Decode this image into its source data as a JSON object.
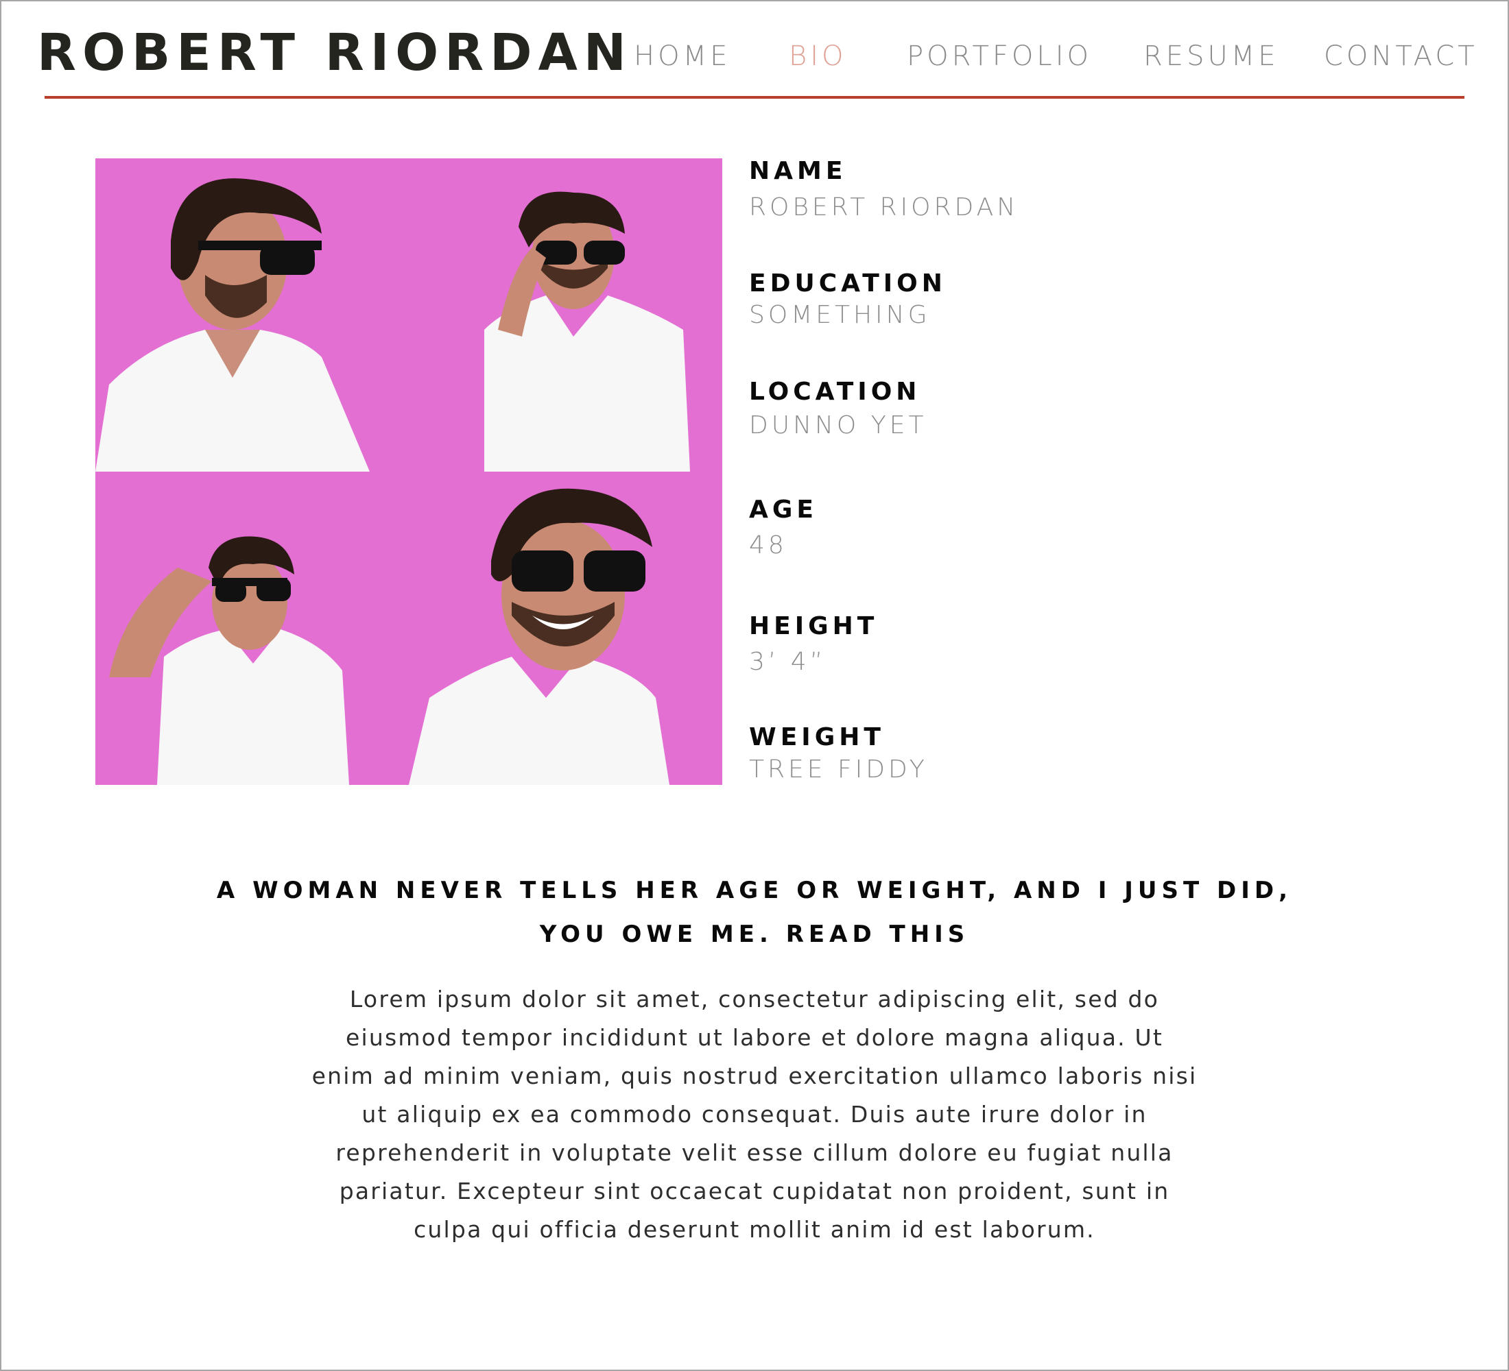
{
  "site": {
    "title": "ROBERT RIORDAN"
  },
  "nav": {
    "items": [
      {
        "label": "HOME",
        "active": false
      },
      {
        "label": "BIO",
        "active": true
      },
      {
        "label": "PORTFOLIO",
        "active": false
      },
      {
        "label": "RESUME",
        "active": false
      },
      {
        "label": "CONTACT",
        "active": false
      }
    ]
  },
  "profile": {
    "fields": [
      {
        "label": "NAME",
        "value": "ROBERT RIORDAN"
      },
      {
        "label": "EDUCATION",
        "value": "SOMETHING"
      },
      {
        "label": "LOCATION",
        "value": "DUNNO YET"
      },
      {
        "label": "AGE",
        "value": "48"
      },
      {
        "label": "HEIGHT",
        "value": "3’ 4”"
      },
      {
        "label": "WEIGHT",
        "value": "TREE FIDDY"
      }
    ]
  },
  "quote": {
    "lines": [
      "A WOMAN NEVER TELLS HER AGE OR WEIGHT, AND I JUST DID,",
      "YOU OWE ME. READ THIS"
    ]
  },
  "bio": {
    "lines": [
      "Lorem ipsum dolor sit amet, consectetur adipiscing elit, sed do",
      "eiusmod tempor incididunt ut labore et dolore magna aliqua. Ut",
      "enim ad minim veniam, quis nostrud exercitation ullamco laboris nisi",
      "ut aliquip ex ea commodo consequat. Duis aute irure dolor in",
      "reprehenderit in voluptate velit esse cillum dolore eu fugiat nulla",
      "pariatur. Excepteur sint occaecat cupidatat non proident, sunt in",
      "culpa qui officia deserunt mollit anim id est laborum."
    ]
  },
  "colors": {
    "accent_rule": "#b83f2c",
    "nav_active": "#e0a094",
    "nav_inactive": "#8a8a8a",
    "photo_background": "#e46fd3",
    "title": "#23251e"
  }
}
